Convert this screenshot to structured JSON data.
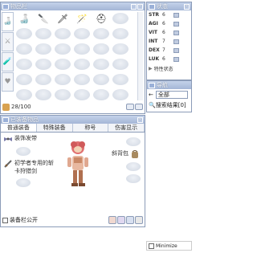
{
  "inventory": {
    "title": "物品栏",
    "count": "28/100"
  },
  "stats": {
    "title": "状态",
    "rows": [
      {
        "name": "STR",
        "value": "6"
      },
      {
        "name": "AGI",
        "value": "6"
      },
      {
        "name": "VIT",
        "value": "6"
      },
      {
        "name": "INT",
        "value": "7"
      },
      {
        "name": "DEX",
        "value": "7"
      },
      {
        "name": "LUK",
        "value": "6"
      }
    ],
    "extra_label": "特性状态"
  },
  "nav": {
    "title": "导航",
    "select_value": "全部",
    "result": "搜索结果[0]"
  },
  "equipment": {
    "title": "已装备物品",
    "tabs": [
      "普通装备",
      "特殊装备",
      "称号",
      "伤害显示"
    ],
    "left_slots": [
      "装饰发带",
      "初学者专用的斩卡狩猎剑"
    ],
    "right_slot": "斜背包",
    "public_label": "装备栏公开"
  },
  "minimize_label": "Minimize"
}
